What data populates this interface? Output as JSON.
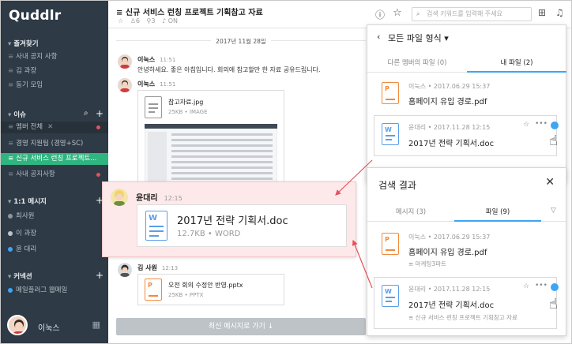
{
  "app": {
    "logo": "Quddlr"
  },
  "sidebar": {
    "fav_label": "즐겨찾기",
    "fav_items": [
      {
        "label": "사내 공지 사항"
      },
      {
        "label": "김 과장"
      },
      {
        "label": "동기 모임"
      }
    ],
    "issue_label": "이슈",
    "issue_items": [
      {
        "label": "멤버 전체"
      },
      {
        "label": "경영 지원팀 (경영+SC)"
      },
      {
        "label": "신규 서비스 런칭 프로젝트..."
      },
      {
        "label": "사내 공지사항"
      }
    ],
    "dm_label": "1:1 메시지",
    "dm_items": [
      {
        "label": "최사원"
      },
      {
        "label": "이 과장"
      },
      {
        "label": "윤 대리"
      }
    ],
    "connect_label": "커넥션",
    "connect_items": [
      {
        "label": "메일플러그 웹메일"
      }
    ],
    "footer_name": "이눅스"
  },
  "topbar": {
    "title": "신규 서비스 런칭 프로젝트 기획참고 자료",
    "members": "6",
    "pins": "3",
    "status": "ON",
    "search_placeholder": "검색 키워드를 입력해 주세요"
  },
  "chat": {
    "date": "2017년 11월 28일",
    "messages": [
      {
        "name": "이눅스",
        "time": "11:51",
        "text": "안녕하세요. 좋은 아침입니다. 회의에 참고할만 한 자료 공유드립니다."
      },
      {
        "name": "이눅스",
        "time": "11:51",
        "file": {
          "name": "참고자료.jpg",
          "meta": "25KB • IMAGE"
        }
      },
      {
        "name": "김 사원",
        "time": "12:13",
        "file": {
          "name": "오전 회의 수정안 반영.pptx",
          "meta": "25KB • PPTX"
        }
      }
    ],
    "goto_latest": "최신 메시지로 가기 ↓"
  },
  "zoom": {
    "name": "윤대리",
    "time": "12:15",
    "file_name": "2017년 전략 기획서.doc",
    "file_meta": "12.7KB • WORD",
    "icon_letter": "W"
  },
  "files_panel": {
    "title": "모든 파일 형식",
    "tabs": [
      {
        "label": "다른 멤버의 파일 (0)"
      },
      {
        "label": "내 파일 (2)"
      }
    ],
    "items": [
      {
        "meta": "이눅스 • 2017.06.29 15:37",
        "name": "홈페이지 유입 경로.pdf",
        "icon": "P"
      },
      {
        "meta": "윤대리 • 2017.11.28 12:15",
        "name": "2017년 전략 기획서.doc",
        "icon": "W"
      }
    ]
  },
  "search_panel": {
    "title": "검색 결과",
    "tabs": [
      {
        "label": "메시지 (3)"
      },
      {
        "label": "파일 (9)"
      }
    ],
    "items": [
      {
        "meta": "이눅스 • 2017.06.29 15:37",
        "name": "홈페이지 유입 경로.pdf",
        "sub": "마케팅3파트",
        "icon": "P"
      },
      {
        "meta": "윤대리 • 2017.11.28 12:15",
        "name": "2017년 전략 기획서.doc",
        "sub": "신규 서비스 런칭 프로젝트 기획참고 자료",
        "icon": "W"
      }
    ]
  },
  "colors": {
    "accent": "#3da5f4",
    "sidebar": "#2e3a45",
    "active": "#2fb57f",
    "alert": "#e8505b",
    "word": "#5a9ee8",
    "ppt": "#f08a3c"
  },
  "icons": {
    "info": "info-icon",
    "star": "star-icon",
    "search": "search-icon",
    "gift": "gift-icon",
    "bell": "bell-icon"
  }
}
